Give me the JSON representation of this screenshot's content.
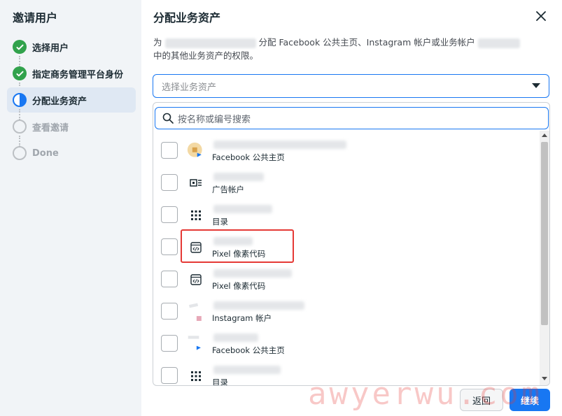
{
  "left_panel": {
    "title": "邀请用户",
    "steps": [
      {
        "label": "选择用户",
        "state": "done"
      },
      {
        "label": "指定商务管理平台身份",
        "state": "done"
      },
      {
        "label": "分配业务资产",
        "state": "active"
      },
      {
        "label": "查看邀请",
        "state": "pending"
      },
      {
        "label": "Done",
        "state": "pending"
      }
    ]
  },
  "main": {
    "title": "分配业务资产",
    "description_prefix": "为",
    "description_mid": "分配 Facebook 公共主页、Instagram 帐户或业务帐户",
    "description_line2": "中的其他业务资产的权限。",
    "select_placeholder": "选择业务资产",
    "search_placeholder": "按名称或编号搜索",
    "assets": [
      {
        "type_label": "Facebook 公共主页",
        "icon": "page-icon"
      },
      {
        "type_label": "广告帐户",
        "icon": "ad-account-icon"
      },
      {
        "type_label": "目录",
        "icon": "catalog-grid-icon"
      },
      {
        "type_label": "Pixel 像素代码",
        "icon": "pixel-code-icon"
      },
      {
        "type_label": "Pixel 像素代码",
        "icon": "pixel-code-icon"
      },
      {
        "type_label": "Instagram 帐户",
        "icon": "instagram-icon"
      },
      {
        "type_label": "Facebook 公共主页",
        "icon": "page-icon"
      },
      {
        "type_label": "目录",
        "icon": "catalog-grid-icon"
      }
    ]
  },
  "footer": {
    "back_label": "返回",
    "continue_label": "继续"
  },
  "watermark": "awyerwu.com",
  "colors": {
    "accent": "#1877f2",
    "success": "#31a24c",
    "highlight": "#e53935"
  }
}
